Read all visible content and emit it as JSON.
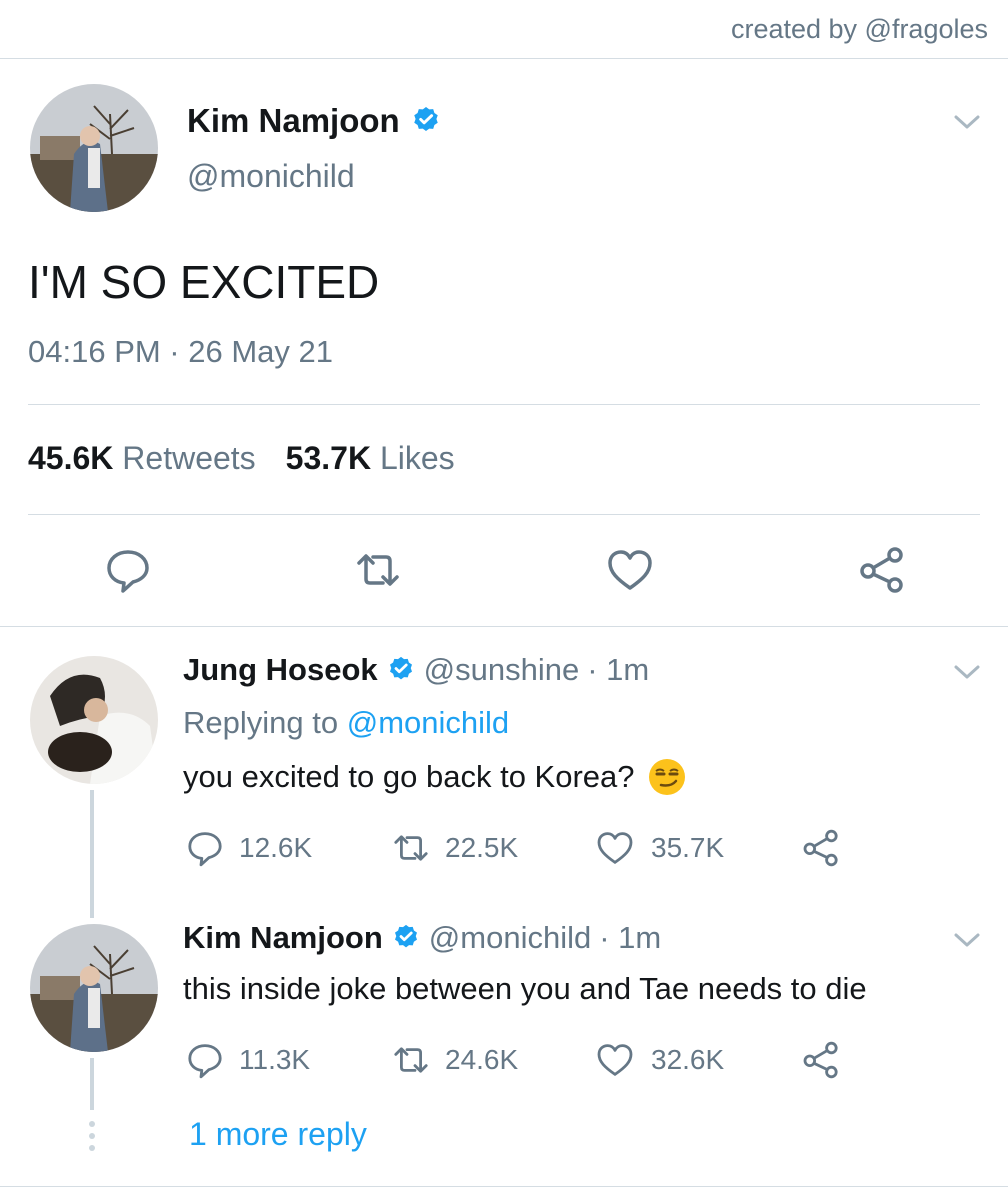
{
  "credit": "created by @fragoles",
  "main_tweet": {
    "name": "Kim Namjoon",
    "handle": "@monichild",
    "text": "I'M SO EXCITED",
    "timestamp": "04:16 PM · 26 May 21",
    "retweets_count": "45.6K",
    "retweets_label": "Retweets",
    "likes_count": "53.7K",
    "likes_label": "Likes",
    "verified": true
  },
  "replies": [
    {
      "name": "Jung Hoseok",
      "handle": "@sunshine",
      "time": "· 1m",
      "replying_prefix": "Replying to",
      "replying_to": "@monichild",
      "text": "you excited to go back to Korea?",
      "emoji": "smirking-face-emoji",
      "replies": "12.6K",
      "retweets": "22.5K",
      "likes": "35.7K"
    },
    {
      "name": "Kim Namjoon",
      "handle": "@monichild",
      "time": "· 1m",
      "text": "this inside joke between you and Tae needs to die",
      "replies": "11.3K",
      "retweets": "24.6K",
      "likes": "32.6K"
    }
  ],
  "more_replies": "1 more reply",
  "colors": {
    "link": "#1da1f2",
    "muted": "#657786",
    "verified": "#1da1f2",
    "divider": "#d5dde3"
  },
  "icons": [
    "reply-icon",
    "retweet-icon",
    "like-icon",
    "share-icon",
    "chevron-down-icon",
    "verified-badge-icon"
  ]
}
